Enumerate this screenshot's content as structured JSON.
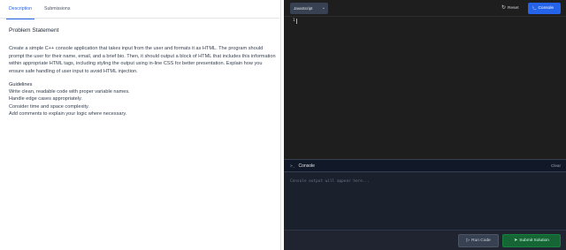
{
  "tabs": {
    "description": "Description",
    "submissions": "Submissions"
  },
  "problem": {
    "heading": "Problem Statement",
    "statement": "Create a simple C++ console application that takes input from the user and formats it as HTML. The program should prompt the user for their name, email, and a brief bio. Then, it should output a block of HTML that includes this information within appropriate HTML tags, including styling the output using in-line CSS for better presentation. Explain how you ensure safe handling of user input to avoid HTML injection."
  },
  "guidelines": {
    "heading": "Guidelines",
    "items": [
      "Write clean, readable code with proper variable names.",
      "Handle edge cases appropriately.",
      "Consider time and space complexity.",
      "Add comments to explain your logic where necessary."
    ]
  },
  "toolbar": {
    "language": "JavaScript",
    "reset_label": "Reset",
    "console_label": "Console"
  },
  "editor": {
    "line_number": "1"
  },
  "console": {
    "title": "Console",
    "clear_label": "Clear",
    "output_placeholder": "Console output will appear here..."
  },
  "footer": {
    "run_label": "Run Code",
    "submit_label": "Submit Solution"
  },
  "colors": {
    "accent": "#2563eb",
    "submit": "#166534",
    "editor_bg": "#1e1e1e"
  }
}
